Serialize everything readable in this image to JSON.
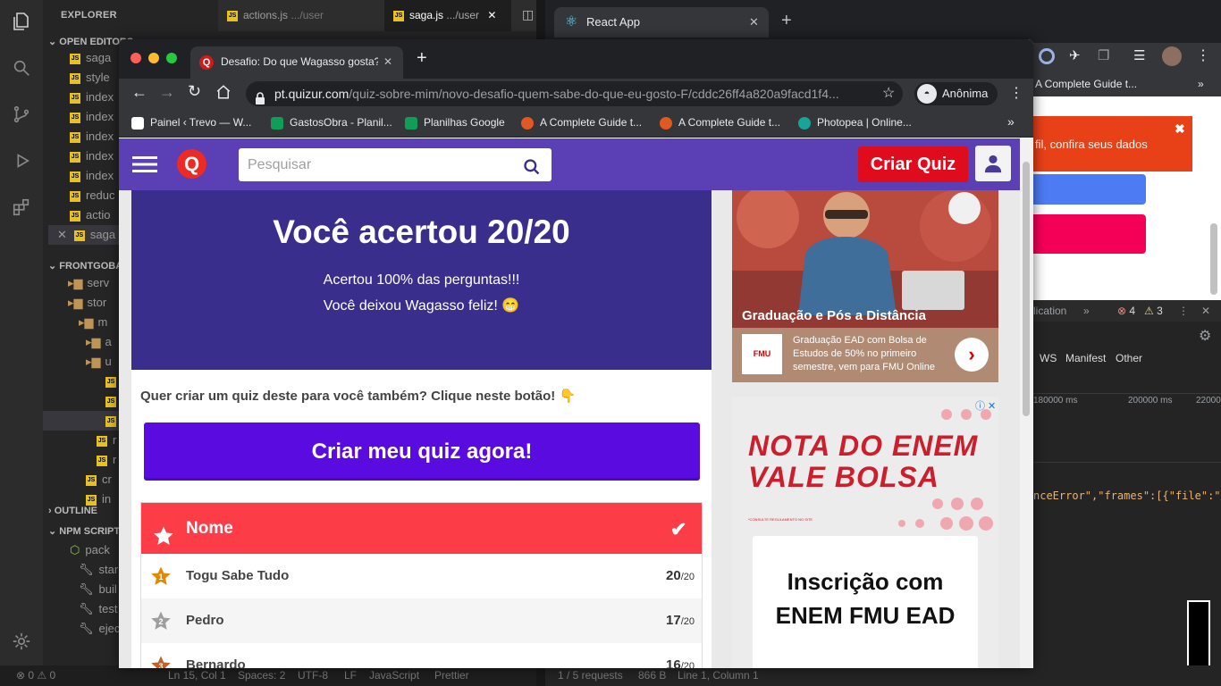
{
  "vscode": {
    "explorer_title": "EXPLORER",
    "tabs": [
      {
        "name": "actions.js",
        "path": ".../user",
        "active": false
      },
      {
        "name": "saga.js",
        "path": ".../user",
        "active": true
      }
    ],
    "sections": {
      "open_editors": "OPEN EDITORS",
      "project": "FRONTGOBAR",
      "outline": "OUTLINE",
      "npm_scripts": "NPM SCRIPTS"
    },
    "open_editor_files": [
      "saga",
      "style",
      "index",
      "index",
      "index",
      "index",
      "index",
      "reduc",
      "actio",
      "saga"
    ],
    "tree_items": [
      "serv",
      "stor",
      "m",
      "a",
      "u",
      "",
      "",
      "",
      "r",
      "r",
      "cr",
      "in"
    ],
    "npm_items": [
      "pack",
      "star",
      "buil",
      "test",
      "ejec"
    ],
    "status": {
      "problems": "0",
      "warnings": "0",
      "position": "Ln 15, Col 1",
      "spaces": "Spaces: 2",
      "encoding": "UTF-8",
      "eol": "LF",
      "language": "JavaScript",
      "formatter": "Prettier"
    }
  },
  "bg_browser": {
    "tab_title": "React App",
    "bookmark": "A Complete Guide t...",
    "toast_text": "fil, confira seus dados",
    "devtools": {
      "tab": "lication",
      "errors": "4",
      "warnings": "3"
    },
    "net_filters": [
      "WS",
      "Manifest",
      "Other"
    ],
    "timeline": [
      "180000 ms",
      "200000 ms",
      "220000"
    ],
    "code": "nceError\",\"frames\":[{\"file\":\"src",
    "status": {
      "requests": "1 / 5 requests",
      "size": "866 B",
      "cursor": "Line 1, Column 1"
    }
  },
  "browser": {
    "tab_title": "Desafio: Do que Wagasso gosta?",
    "url_domain": "pt.quizur.com",
    "url_path": "/quiz-sobre-mim/novo-desafio-quem-sabe-do-que-eu-gosto-F/cddc26ff4a820a9facd1f4...",
    "profile": "Anônima",
    "bookmarks": [
      {
        "label": "Painel ‹ Trevo — W...",
        "color": "#ffffff"
      },
      {
        "label": "GastosObra - Planil...",
        "color": "#0f9d58"
      },
      {
        "label": "Planilhas Google",
        "color": "#0f9d58"
      },
      {
        "label": "A Complete Guide t...",
        "color": "#e25822"
      },
      {
        "label": "A Complete Guide t...",
        "color": "#e25822"
      },
      {
        "label": "Photopea | Online...",
        "color": "#18a497"
      }
    ]
  },
  "quizur": {
    "search_placeholder": "Pesquisar",
    "create_quiz": "Criar Quiz",
    "result_title": "Você acertou 20/20",
    "result_line1": "Acertou 100% das perguntas!!!",
    "result_line2": "Você deixou Wagasso feliz! 😁",
    "cta_text": "Quer criar um quiz deste para você também? Clique neste botão! 👇",
    "cta_button": "Criar meu quiz agora!",
    "ranking_header": "Nome",
    "ranking": [
      {
        "rank": "1",
        "name": "Togu Sabe Tudo",
        "score": "20",
        "total": "/20",
        "color": "#e08a00"
      },
      {
        "rank": "2",
        "name": "Pedro",
        "score": "17",
        "total": "/20",
        "color": "#9e9e9e"
      },
      {
        "rank": "3",
        "name": "Bernardo",
        "score": "16",
        "total": "/20",
        "color": "#c0622b"
      }
    ]
  },
  "ads": {
    "ad1_title": "Graduação e Pós a Distância",
    "ad1_logo": "FMU",
    "ad1_text": "Graduação EAD com Bolsa de Estudos de 50% no primeiro semestre, vem para FMU Online",
    "ad1_go": "›",
    "ad2_line1": "NOTA DO ENEM",
    "ad2_line2": "VALE BOLSA",
    "ad2_small": "*CONSULTE REGULAMENTO NO SITE",
    "ad2_box1": "Inscrição com",
    "ad2_box2": "ENEM FMU EAD",
    "ad2_info": "ⓘ ✕"
  },
  "colors": {
    "quizur_purple": "#5b3fb4",
    "hero": "#3a2e8c",
    "cta": "#5a0ce0",
    "create_red": "#e00b1c",
    "rank_red": "#fc3d47"
  }
}
